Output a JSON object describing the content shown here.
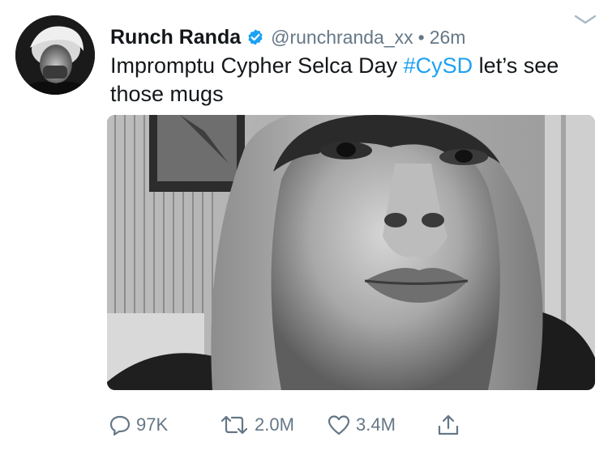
{
  "tweet": {
    "author": {
      "display_name": "Runch Randa",
      "handle": "@runchranda_xx",
      "verified": true
    },
    "separator": "•",
    "time": "26m",
    "text": {
      "before_hashtag": "Impromptu Cypher Selca Day ",
      "hashtag": "#CySD",
      "after_hashtag": " let’s see those mugs"
    },
    "media": {
      "type": "photo",
      "style": "black-and-white selfie"
    },
    "actions": {
      "reply_count": "97K",
      "retweet_count": "2.0M",
      "like_count": "3.4M"
    },
    "icons": {
      "caret": "chevron-down-icon",
      "verified": "verified-badge-icon",
      "reply": "reply-icon",
      "retweet": "retweet-icon",
      "like": "heart-icon",
      "share": "share-icon"
    },
    "colors": {
      "name": "#14171a",
      "secondary": "#657786",
      "hashtag": "#1da1f2",
      "verified": "#1da1f2"
    }
  }
}
